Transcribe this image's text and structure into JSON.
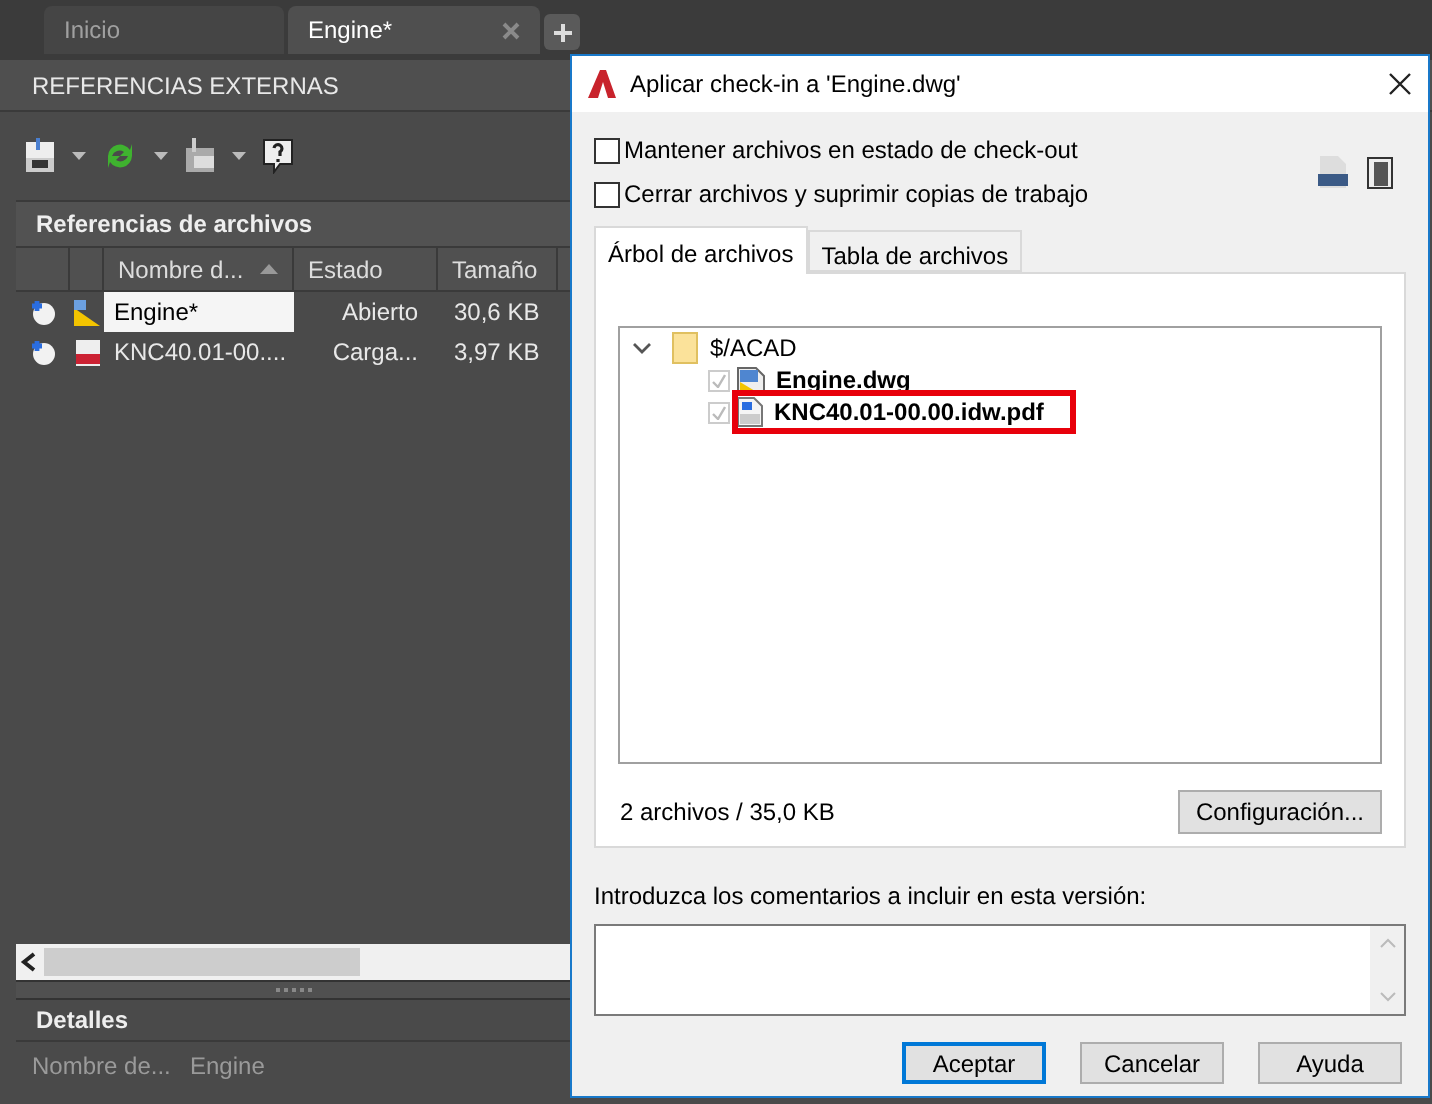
{
  "tabs": [
    {
      "label": "Inicio",
      "selected": false,
      "closable": false
    },
    {
      "label": "Engine*",
      "selected": true,
      "closable": true
    }
  ],
  "palette": {
    "title": "REFERENCIAS EXTERNAS",
    "section": "Referencias de archivos",
    "columns": [
      "Nombre d...",
      "Estado",
      "Tamaño"
    ],
    "rows": [
      {
        "name": "Engine*",
        "status": "Abierto",
        "size": "30,6 KB",
        "kind": "dwg",
        "selected": true
      },
      {
        "name": "KNC40.01-00....",
        "status": "Carga...",
        "size": "3,97 KB",
        "kind": "pdf",
        "selected": false
      }
    ],
    "details": {
      "title": "Detalles",
      "rows": [
        {
          "label": "Nombre de...",
          "value": "Engine"
        }
      ]
    }
  },
  "dialog": {
    "title": "Aplicar check-in a 'Engine.dwg'",
    "options": [
      {
        "label": "Mantener archivos en estado de check-out",
        "checked": false
      },
      {
        "label": "Cerrar archivos y suprimir copias de trabajo",
        "checked": false
      }
    ],
    "tabs": [
      {
        "label": "Árbol de archivos",
        "selected": true
      },
      {
        "label": "Tabla de archivos",
        "selected": false
      }
    ],
    "tree": [
      {
        "label": "$/ACAD",
        "kind": "folder",
        "expanded": true,
        "children": [
          {
            "label": "Engine.dwg",
            "kind": "dwg",
            "checked": true,
            "highlighted": false
          },
          {
            "label": "KNC40.01-00.00.idw.pdf",
            "kind": "pdf",
            "checked": true,
            "highlighted": true
          }
        ]
      }
    ],
    "summary": "2 archivos / 35,0 KB",
    "settings_button": "Configuración...",
    "comment_label": "Introduzca los comentarios a incluir en esta versión:",
    "buttons": [
      {
        "label": "Aceptar",
        "default": true
      },
      {
        "label": "Cancelar",
        "default": false
      },
      {
        "label": "Ayuda",
        "default": false
      }
    ]
  }
}
